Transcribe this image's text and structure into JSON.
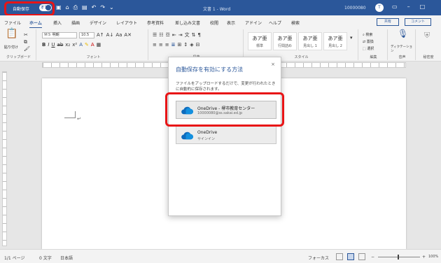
{
  "titlebar": {
    "autosave_label": "自動保存",
    "autosave_state": "オフ",
    "doc_title": "文書 1 - Word",
    "user_id": "10000080",
    "user_initial": "T",
    "accent": "#2b579a",
    "highlight": "#e81416"
  },
  "tabs": {
    "items": [
      "ファイル",
      "ホーム",
      "挿入",
      "描画",
      "デザイン",
      "レイアウト",
      "参考資料",
      "差し込み文書",
      "校閲",
      "表示",
      "アドイン",
      "ヘルプ",
      "検索"
    ],
    "active_index": 1,
    "share": "共有",
    "comment": "コメント"
  },
  "ribbon": {
    "clipboard": {
      "paste": "貼り付け",
      "label": "クリップボード"
    },
    "font": {
      "name": "ＭＳ 明朝",
      "size": "10.5",
      "label": "フォント"
    },
    "paragraph": {
      "label": "段落"
    },
    "styles": {
      "cards": [
        {
          "sample": "あア亜",
          "name": "標準"
        },
        {
          "sample": "あア亜",
          "name": "行間詰め"
        },
        {
          "sample": "あア亜",
          "name": "見出し 1"
        },
        {
          "sample": "あア亜",
          "name": "見出し 2"
        }
      ],
      "label": "スタイル"
    },
    "editing": {
      "find": "検索",
      "replace": "置換",
      "select": "選択",
      "label": "編集"
    },
    "voice": {
      "dictate": "ディクテーション",
      "label": "音声"
    },
    "sensitivity": {
      "label": "秘密度"
    }
  },
  "dialog": {
    "title": "自動保存を有効にする方法",
    "description": "ファイルをアップロードするだけで、変更が行われたときに自動的に保存されます。",
    "close": "×",
    "locations": [
      {
        "name": "OneDrive - 堺市教育センター",
        "sub": "10000080@ss.sakai.ed.jp"
      },
      {
        "name": "OneDrive",
        "sub": "サインイン"
      }
    ]
  },
  "status": {
    "page": "1/1 ページ",
    "words": "0 文字",
    "language": "日本語",
    "focus": "フォーカス",
    "zoom": "100%"
  }
}
